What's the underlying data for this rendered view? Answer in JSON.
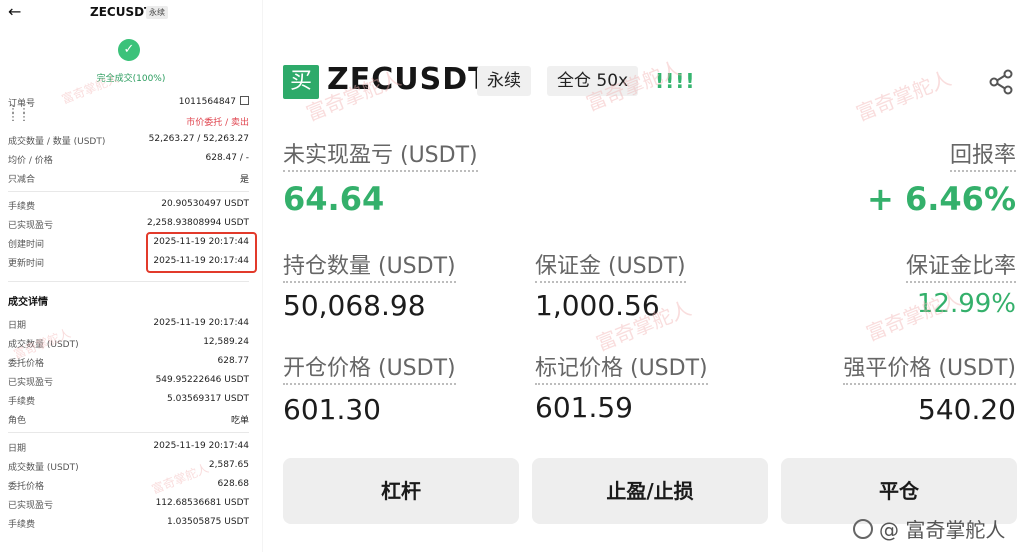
{
  "left": {
    "back_icon": "back-arrow-icon",
    "title": "ZECUSDT",
    "title_tag": "永续",
    "status_text": "完全成交(100%)",
    "order_rows": [
      {
        "label": "订单号",
        "value": "1011564847"
      },
      {
        "label": "",
        "value": "市价委托 / 卖出"
      },
      {
        "label": "成交数量 / 数量 (USDT)",
        "value": "52,263.27 / 52,263.27"
      },
      {
        "label": "均价 / 价格",
        "value": "628.47 / -"
      },
      {
        "label": "只减合",
        "value": "是"
      },
      {
        "label": "手续费",
        "value": "20.90530497 USDT"
      },
      {
        "label": "已实现盈亏",
        "value": "2,258.93808994 USDT"
      },
      {
        "label": "创建时间",
        "value": "2025-11-19 20:17:44"
      },
      {
        "label": "更新时间",
        "value": "2025-11-19 20:17:44"
      }
    ],
    "section_title": "成交详情",
    "fill1": [
      {
        "label": "日期",
        "value": "2025-11-19 20:17:44"
      },
      {
        "label": "成交数量 (USDT)",
        "value": "12,589.24"
      },
      {
        "label": "委托价格",
        "value": "628.77"
      },
      {
        "label": "已实现盈亏",
        "value": "549.95222646 USDT"
      },
      {
        "label": "手续费",
        "value": "5.03569317 USDT"
      },
      {
        "label": "角色",
        "value": "吃单"
      }
    ],
    "fill2": [
      {
        "label": "日期",
        "value": "2025-11-19 20:17:44"
      },
      {
        "label": "成交数量 (USDT)",
        "value": "2,587.65"
      },
      {
        "label": "委托价格",
        "value": "628.68"
      },
      {
        "label": "已实现盈亏",
        "value": "112.68536681 USDT"
      },
      {
        "label": "手续费",
        "value": "1.03505875 USDT"
      }
    ],
    "highlight_color": "#e23a2b",
    "green_color": "#2a9c5e",
    "sell_color": "#e0454f"
  },
  "right": {
    "badge": "买",
    "pair": "ZECUSDT",
    "tag_perp": "永续",
    "tag_margin": "全仓 50x",
    "bars": "!!!!",
    "share_icon": "share-icon",
    "unrealized_label": "未实现盈亏 (USDT)",
    "unrealized_value": "64.64",
    "roi_label": "回报率",
    "roi_value": "+ 6.46%",
    "position_label": "持仓数量 (USDT)",
    "position_value": "50,068.98",
    "margin_label": "保证金 (USDT)",
    "margin_value": "1,000.56",
    "margin_ratio_label": "保证金比率",
    "margin_ratio_value": "12.99%",
    "entry_label": "开仓价格 (USDT)",
    "entry_value": "601.30",
    "mark_label": "标记价格 (USDT)",
    "mark_value": "601.59",
    "liq_label": "强平价格 (USDT)",
    "liq_value": "540.20",
    "btn_leverage": "杠杆",
    "btn_tpsl": "止盈/止损",
    "btn_close": "平仓",
    "accent_green": "#34b06b"
  },
  "watermark": "富奇掌舵人",
  "footer_watermark": "@ 富奇掌舵人"
}
